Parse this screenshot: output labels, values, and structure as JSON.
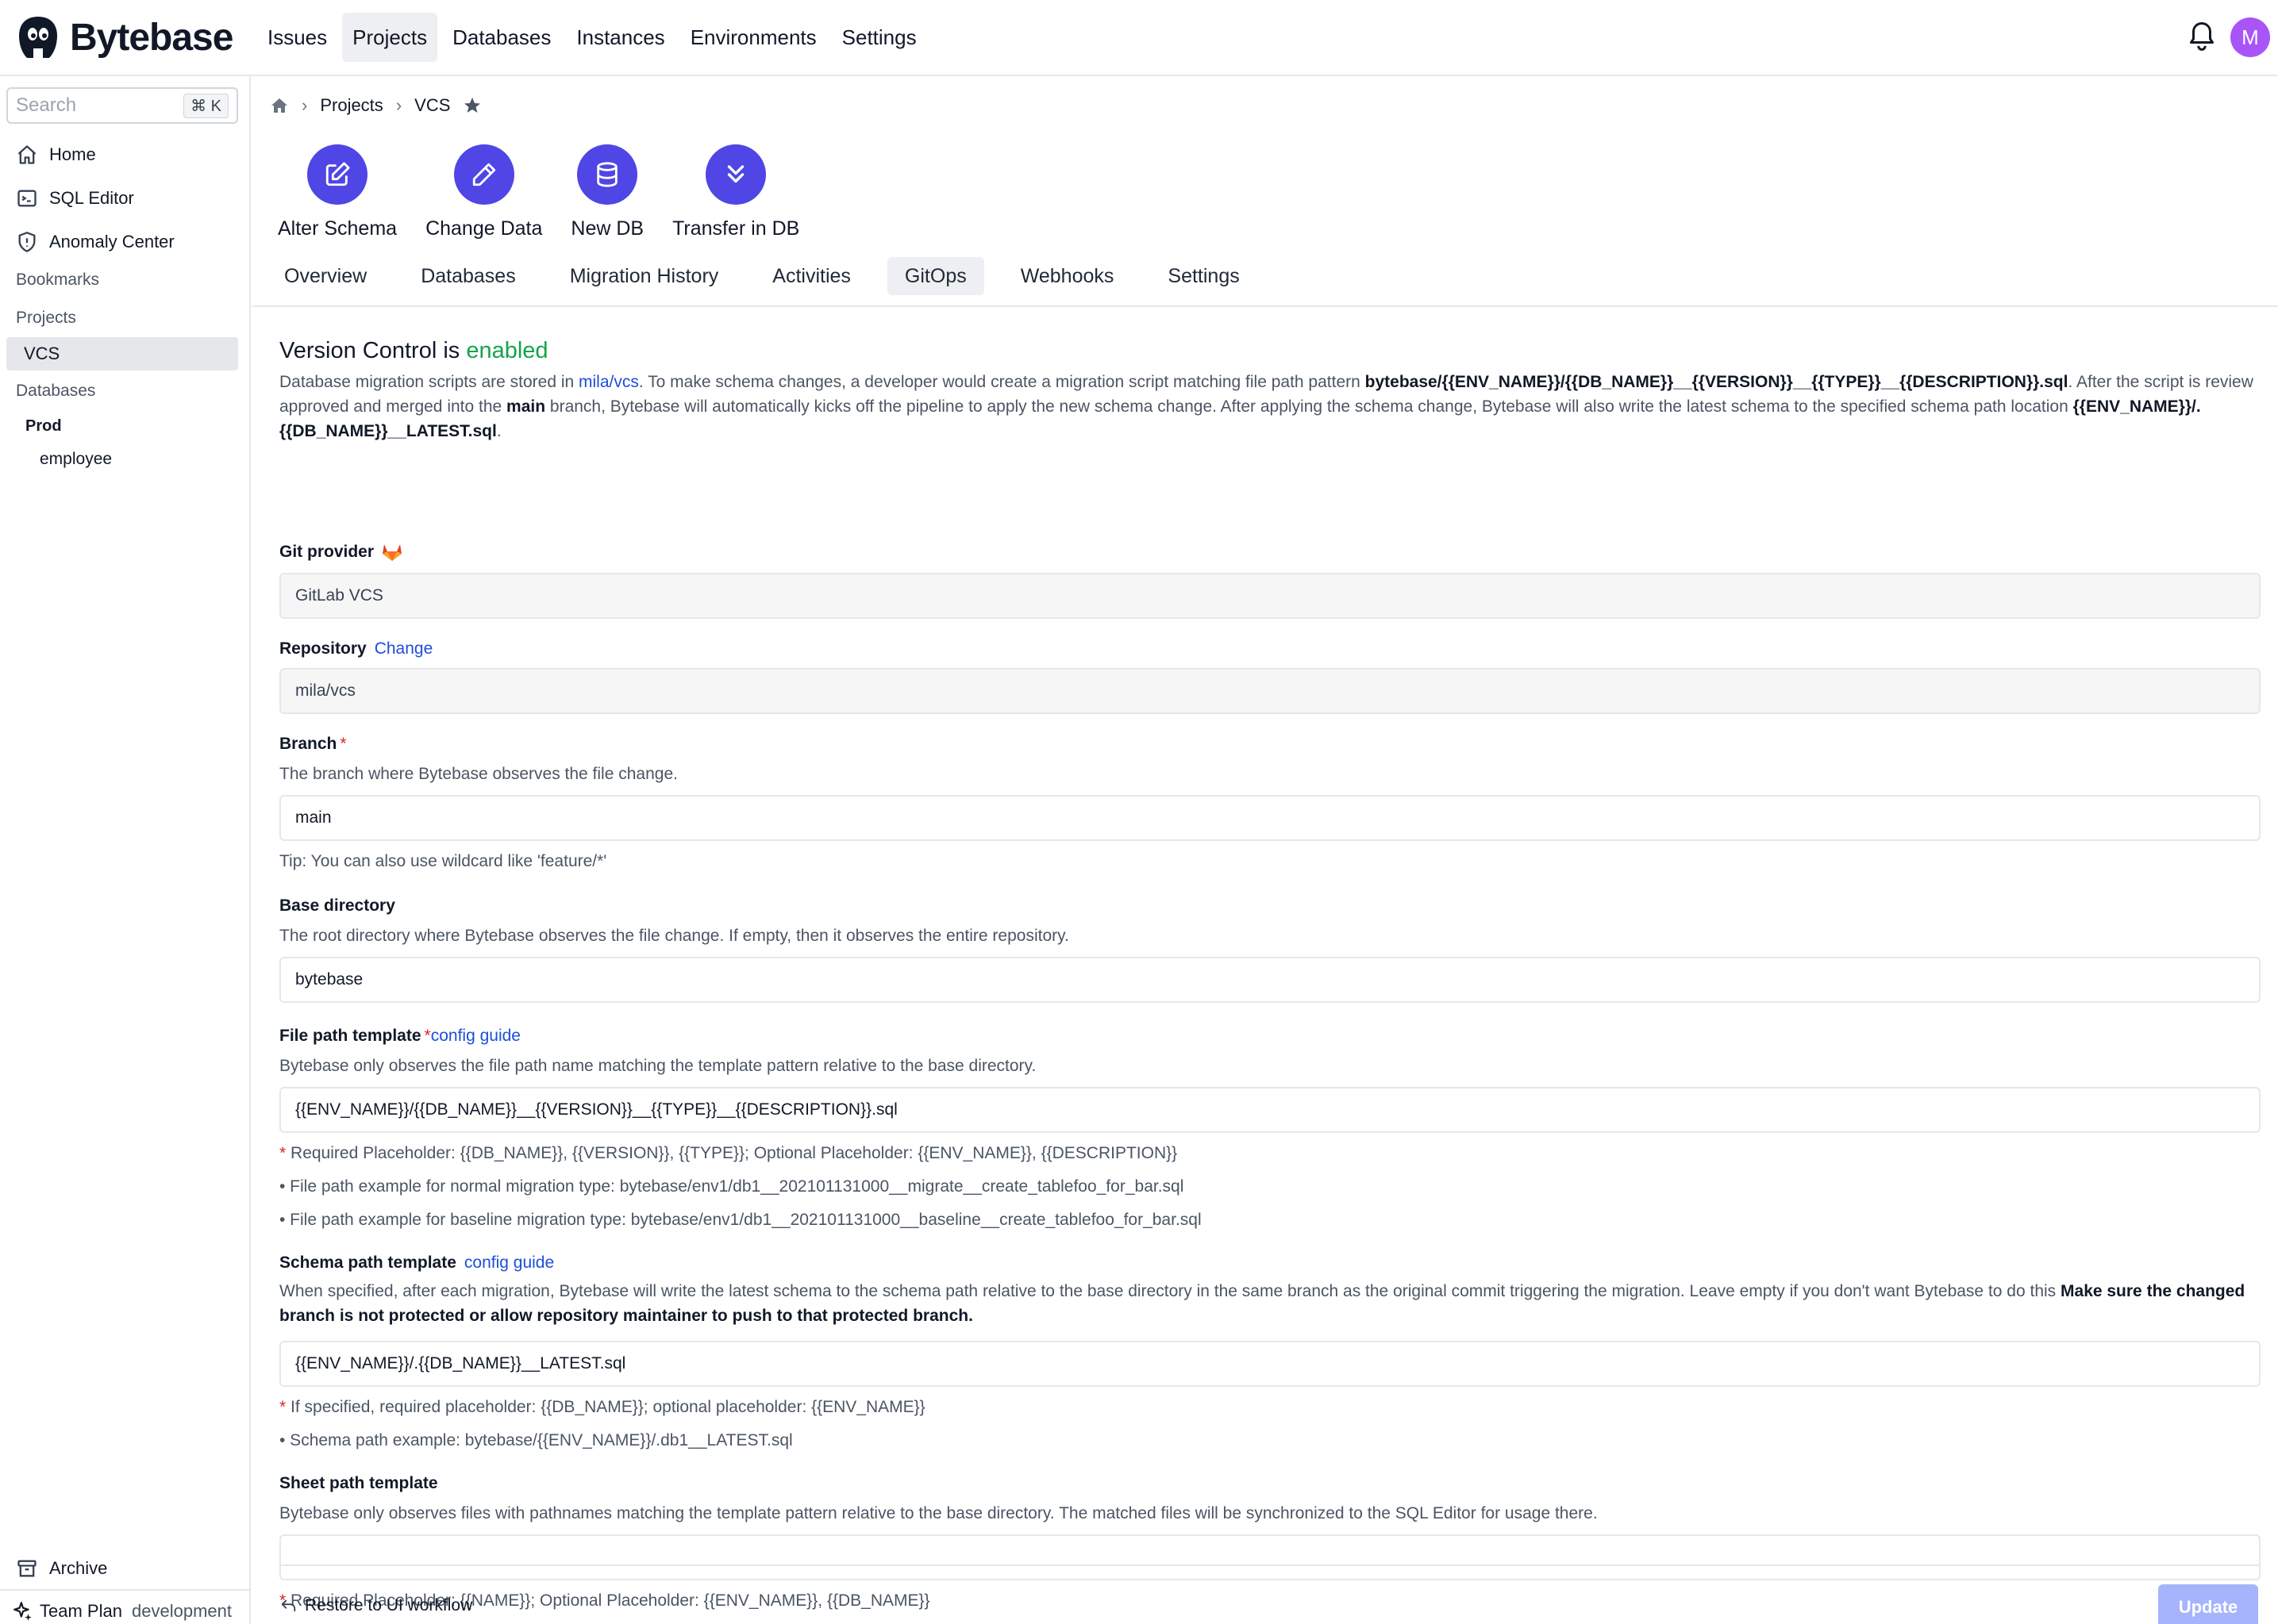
{
  "brand": {
    "name": "Bytebase"
  },
  "topnav": {
    "items": [
      "Issues",
      "Projects",
      "Databases",
      "Instances",
      "Environments",
      "Settings"
    ],
    "active": "Projects",
    "avatar_initial": "M"
  },
  "sidebar": {
    "search_placeholder": "Search",
    "search_shortcut": "⌘ K",
    "links": {
      "home": "Home",
      "sql_editor": "SQL Editor",
      "anomaly_center": "Anomaly Center"
    },
    "sections": {
      "bookmarks": "Bookmarks",
      "projects": "Projects",
      "databases": "Databases"
    },
    "project": "VCS",
    "environment": "Prod",
    "database": "employee",
    "archive": "Archive",
    "plan": "Team Plan",
    "env_tag": "development"
  },
  "breadcrumb": {
    "projects": "Projects",
    "current": "VCS"
  },
  "quick_actions": [
    "Alter Schema",
    "Change Data",
    "New DB",
    "Transfer in DB"
  ],
  "tabs": {
    "items": [
      "Overview",
      "Databases",
      "Migration History",
      "Activities",
      "GitOps",
      "Webhooks",
      "Settings"
    ],
    "active": "GitOps"
  },
  "gitops": {
    "title_prefix": "Version Control is",
    "title_status": "enabled",
    "description": {
      "part1": "Database migration scripts are stored in",
      "repo_link": "mila/vcs",
      "part2": ". To make schema changes, a developer would create a migration script matching file path pattern",
      "pattern": "bytebase/{{ENV_NAME}}/{{DB_NAME}}__{{VERSION}}__{{TYPE}}__{{DESCRIPTION}}.sql",
      "part3": ". After the script is review approved and merged into the",
      "branch": "main",
      "part4": "branch, Bytebase will automatically kicks off the pipeline to apply the new schema change. After applying the schema change, Bytebase will also write the latest schema to the specified schema path location",
      "schema_location": "{{ENV_NAME}}/.{{DB_NAME}}__LATEST.sql",
      "part5": "."
    },
    "git_provider": {
      "label": "Git provider",
      "value": "GitLab VCS"
    },
    "repository": {
      "label": "Repository",
      "change_link": "Change",
      "value": "mila/vcs"
    },
    "branch": {
      "label": "Branch",
      "required": "*",
      "help": "The branch where Bytebase observes the file change.",
      "value": "main",
      "tip": "Tip: You can also use wildcard like 'feature/*'"
    },
    "base_directory": {
      "label": "Base directory",
      "help": "The root directory where Bytebase observes the file change. If empty, then it observes the entire repository.",
      "value": "bytebase"
    },
    "file_path_template": {
      "label": "File path template",
      "required": "*",
      "guide_link": "config guide",
      "help": "Bytebase only observes the file path name matching the template pattern relative to the base directory.",
      "value": "{{ENV_NAME}}/{{DB_NAME}}__{{VERSION}}__{{TYPE}}__{{DESCRIPTION}}.sql",
      "note_required": "Required Placeholder: {{DB_NAME}}, {{VERSION}}, {{TYPE}}; Optional Placeholder: {{ENV_NAME}}, {{DESCRIPTION}}",
      "example_normal": "• File path example for normal migration type: bytebase/env1/db1__202101131000__migrate__create_tablefoo_for_bar.sql",
      "example_baseline": "• File path example for baseline migration type: bytebase/env1/db1__202101131000__baseline__create_tablefoo_for_bar.sql"
    },
    "schema_path_template": {
      "label": "Schema path template",
      "guide_link": "config guide",
      "help": "When specified, after each migration, Bytebase will write the latest schema to the schema path relative to the base directory in the same branch as the original commit triggering the migration. Leave empty if you don't want Bytebase to do this",
      "help_bold": "Make sure the changed branch is not protected or allow repository maintainer to push to that protected branch.",
      "value": "{{ENV_NAME}}/.{{DB_NAME}}__LATEST.sql",
      "note_required": "If specified, required placeholder: {{DB_NAME}}; optional placeholder: {{ENV_NAME}}",
      "example": "• Schema path example: bytebase/{{ENV_NAME}}/.db1__LATEST.sql"
    },
    "sheet_path_template": {
      "label": "Sheet path template",
      "help": "Bytebase only observes files with pathnames matching the template pattern relative to the base directory. The matched files will be synchronized to the SQL Editor for usage there.",
      "value": "",
      "note_required": "Required Placeholder: {{NAME}}; Optional Placeholder: {{ENV_NAME}}, {{DB_NAME}}"
    },
    "required_mark": "*",
    "restore_link": "Restore to UI workflow",
    "update_button": "Update"
  },
  "colors": {
    "accent": "#4f46e5",
    "enabled": "#16a34a",
    "link": "#1d4ed8",
    "required": "#dc2626",
    "avatar": "#a855f7",
    "gitlab": "#e24329"
  }
}
